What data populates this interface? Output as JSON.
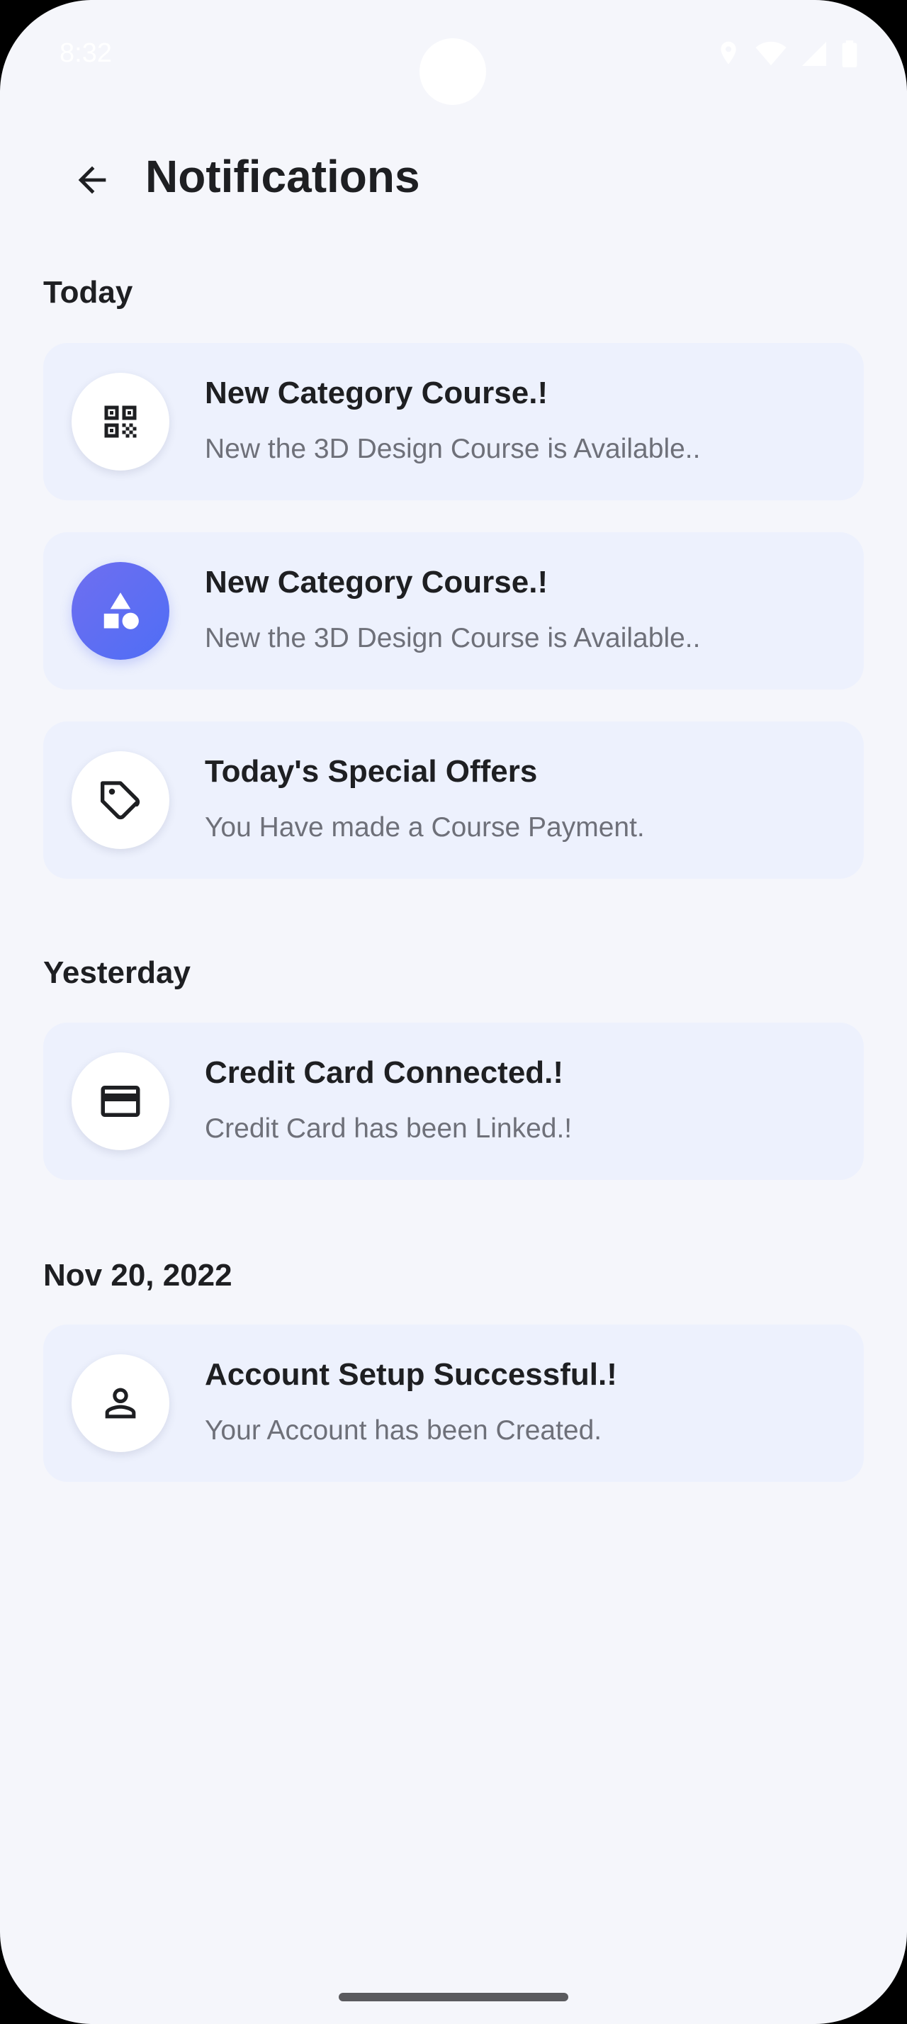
{
  "status_bar": {
    "time": "8:32"
  },
  "header": {
    "title": "Notifications"
  },
  "sections": [
    {
      "heading": "Today",
      "items": [
        {
          "icon": "qr-code-icon",
          "title": "New Category Course.!",
          "subtitle": "New the 3D Design Course is Available.."
        },
        {
          "icon": "shapes-icon",
          "title": "New Category Course.!",
          "subtitle": "New the 3D Design Course is Available.."
        },
        {
          "icon": "tag-icon",
          "title": "Today's Special Offers",
          "subtitle": "You Have made a Course Payment."
        }
      ]
    },
    {
      "heading": "Yesterday",
      "items": [
        {
          "icon": "credit-card-icon",
          "title": "Credit Card Connected.!",
          "subtitle": "Credit Card has been Linked.!"
        }
      ]
    },
    {
      "heading": "Nov 20, 2022",
      "items": [
        {
          "icon": "person-icon",
          "title": "Account Setup Successful.!",
          "subtitle": "Your Account has been Created."
        }
      ]
    }
  ],
  "colors": {
    "background": "#f5f6fb",
    "card": "#edf1fd",
    "accent": "#5b6ef5",
    "text_primary": "#1e1f22",
    "text_secondary": "#6e7079"
  }
}
